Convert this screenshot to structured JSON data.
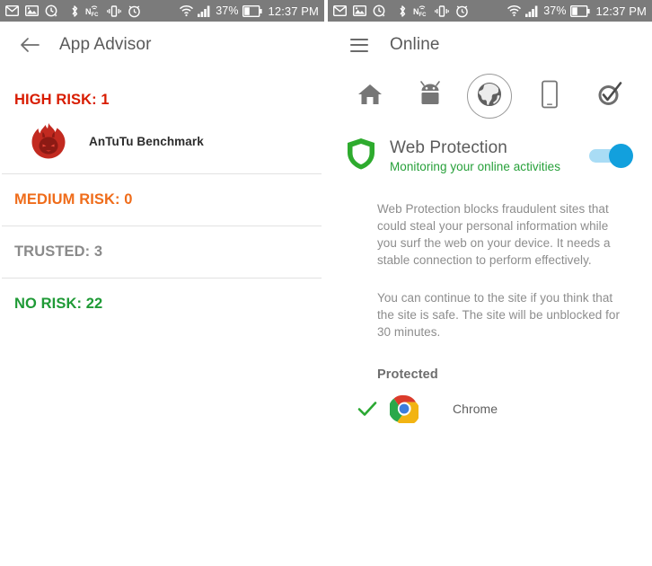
{
  "status_bar": {
    "icons": [
      "email-icon",
      "photo-icon",
      "clock-arrow-icon",
      "bluetooth-icon",
      "nfc-icon",
      "vibrate-icon",
      "alarm-icon",
      "wifi-icon",
      "signal-icon"
    ],
    "battery_percent": "37%",
    "time": "12:37 PM"
  },
  "left_screen": {
    "back_icon": "back-arrow-icon",
    "title": "App Advisor",
    "sections": [
      {
        "key": "high",
        "label": "HIGH RISK: 1",
        "color": "#d81c00"
      },
      {
        "key": "medium",
        "label": "MEDIUM RISK: 0",
        "color": "#ef6c1a"
      },
      {
        "key": "trusted",
        "label": "TRUSTED: 3",
        "color": "#8a8a8a"
      },
      {
        "key": "norisk",
        "label": "NO RISK: 22",
        "color": "#1f9a36"
      }
    ],
    "high_risk_apps": [
      {
        "name": "AnTuTu Benchmark",
        "icon": "antutu-icon"
      }
    ]
  },
  "right_screen": {
    "menu_icon": "hamburger-menu-icon",
    "title": "Online",
    "tabs": [
      {
        "id": "home",
        "icon": "home-icon",
        "selected": false
      },
      {
        "id": "apps",
        "icon": "android-robot-icon",
        "selected": false
      },
      {
        "id": "online",
        "icon": "globe-icon",
        "selected": true
      },
      {
        "id": "device",
        "icon": "smartphone-icon",
        "selected": false
      },
      {
        "id": "clean",
        "icon": "check-circle-icon",
        "selected": false
      }
    ],
    "feature": {
      "icon": "shield-icon",
      "title": "Web Protection",
      "subtitle": "Monitoring your online activities",
      "subtitle_color": "#27a03a",
      "toggle_on": true,
      "toggle_color": "#12a0dd"
    },
    "description": [
      "Web Protection blocks fraudulent sites that could steal your personal information while you surf the web on your device. It needs a stable connection to perform effectively.",
      "You can continue to the site if you think that the site is safe. The site will be unblocked for 30 minutes."
    ],
    "protected_heading": "Protected",
    "protected_browsers": [
      {
        "name": "Chrome",
        "icon": "chrome-icon",
        "check_icon": "green-check-icon"
      }
    ]
  }
}
